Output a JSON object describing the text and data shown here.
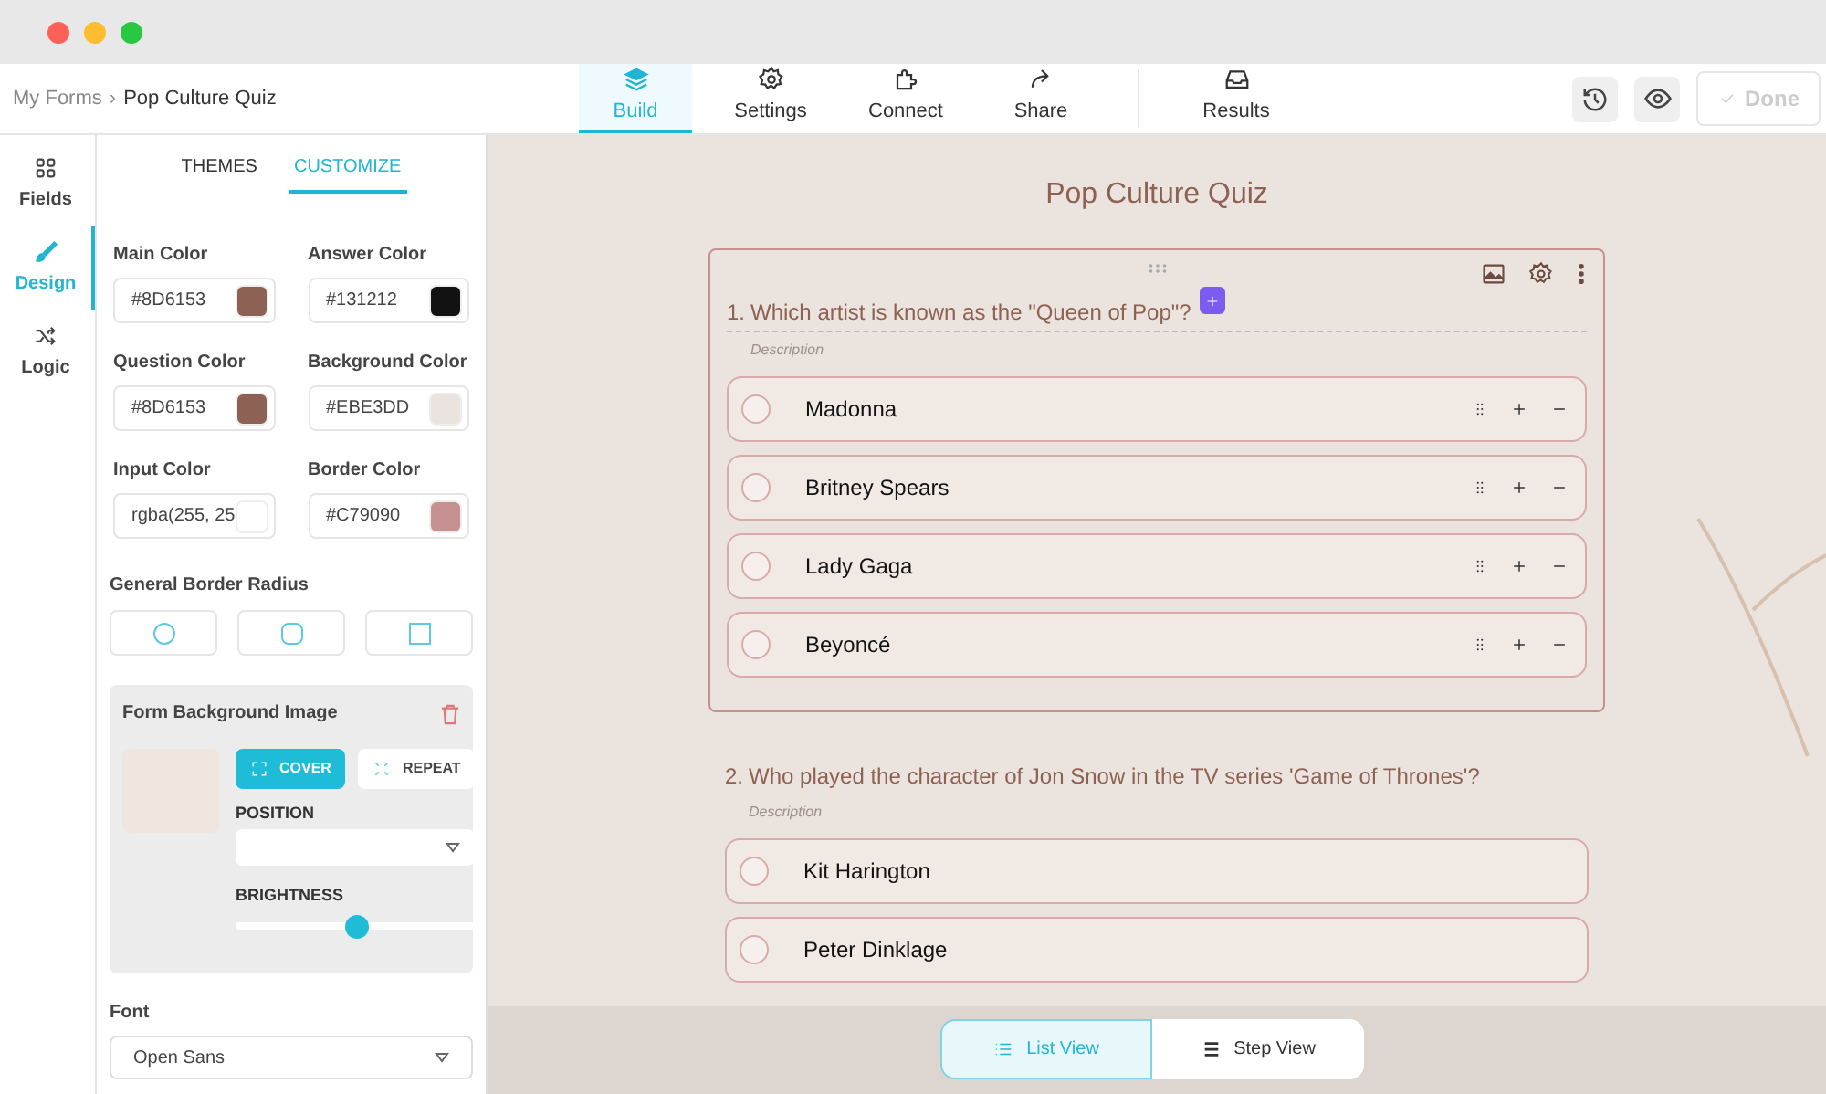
{
  "breadcrumb": {
    "parent": "My Forms",
    "separator": "›",
    "current": "Pop Culture Quiz"
  },
  "nav_tabs": [
    {
      "label": "Build",
      "selected": true
    },
    {
      "label": "Settings",
      "selected": false
    },
    {
      "label": "Connect",
      "selected": false
    },
    {
      "label": "Share",
      "selected": false
    },
    {
      "label": "Results",
      "selected": false
    }
  ],
  "done_button": {
    "label": "Done",
    "disabled": true
  },
  "rail": [
    {
      "label": "Fields",
      "selected": false
    },
    {
      "label": "Design",
      "selected": true
    },
    {
      "label": "Logic",
      "selected": false
    }
  ],
  "panel_tabs": [
    {
      "label": "THEMES",
      "selected": false
    },
    {
      "label": "CUSTOMIZE",
      "selected": true
    }
  ],
  "colors": [
    {
      "label": "Main Color",
      "value": "#8D6153",
      "color": "#8d6153"
    },
    {
      "label": "Answer Color",
      "value": "#131212",
      "color": "#131212"
    },
    {
      "label": "Question Color",
      "value": "#8D6153",
      "color": "#8d6153"
    },
    {
      "label": "Background Color",
      "value": "#EBE3DD",
      "color": "#ebe3dd"
    },
    {
      "label": "Input Color",
      "value": "rgba(255, 25",
      "color": "#ffffff"
    },
    {
      "label": "Border Color",
      "value": "#C79090",
      "color": "#c79090"
    }
  ],
  "border_radius": {
    "label": "General Border Radius",
    "options": [
      {
        "kind": "circle"
      },
      {
        "kind": "rounded"
      },
      {
        "kind": "square"
      }
    ]
  },
  "background_image": {
    "title": "Form Background Image",
    "modes": [
      {
        "label": "COVER",
        "selected": true
      },
      {
        "label": "REPEAT",
        "selected": false
      }
    ],
    "position_label": "POSITION",
    "brightness_label": "BRIGHTNESS",
    "brightness": {
      "level": 0.5
    }
  },
  "font": {
    "label": "Font",
    "value": "Open Sans"
  },
  "form": {
    "title": "Pop Culture Quiz",
    "questions": [
      {
        "number": "1.",
        "text": "Which artist is known as the \"Queen of Pop\"?",
        "description": "Description",
        "active": true,
        "options": [
          {
            "label": "Madonna",
            "selected": false
          },
          {
            "label": "Britney Spears",
            "selected": false
          },
          {
            "label": "Lady Gaga",
            "selected": false
          },
          {
            "label": "Beyoncé",
            "selected": false
          }
        ]
      },
      {
        "number": "2.",
        "text": "Who played the character of Jon Snow in the TV series 'Game of Thrones'?",
        "description": "Description",
        "active": false,
        "options": [
          {
            "label": "Kit Harington",
            "selected": false
          },
          {
            "label": "Peter Dinklage",
            "selected": false
          }
        ]
      }
    ]
  },
  "view_toggle": [
    {
      "label": "List View",
      "selected": true
    },
    {
      "label": "Step View",
      "selected": false
    }
  ]
}
